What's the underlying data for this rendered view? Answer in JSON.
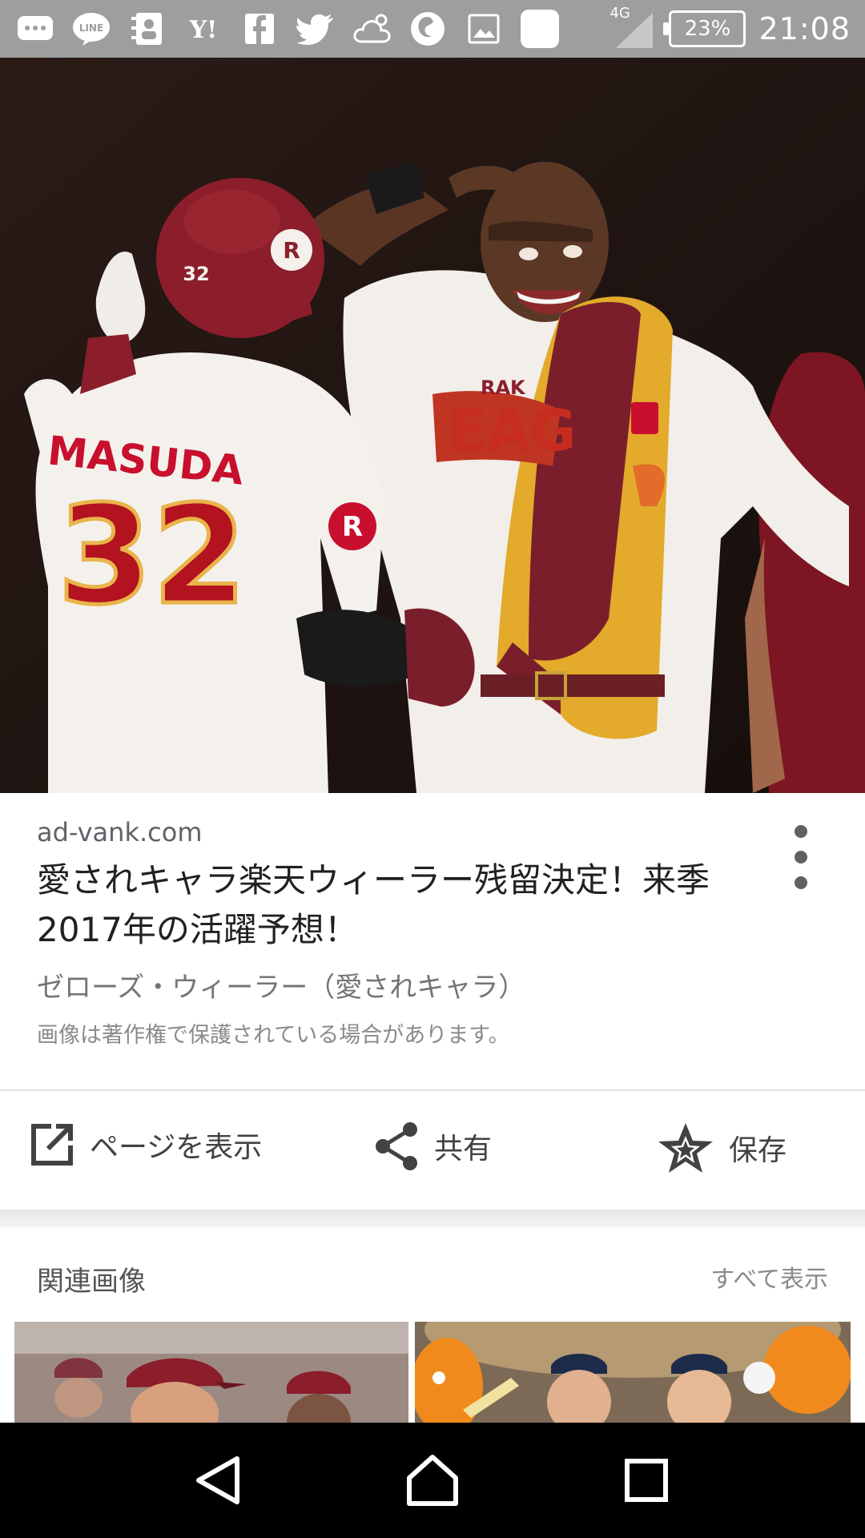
{
  "status_bar": {
    "battery_percent": "23%",
    "network": "4G",
    "time": "21:08",
    "icons": [
      "chat-bubble-icon",
      "line-icon",
      "contacts-icon",
      "yahoo-icon",
      "facebook-icon",
      "twitter-icon",
      "weather-icon",
      "firefox-icon",
      "image-icon",
      "blank-app-icon"
    ]
  },
  "hero": {
    "jersey_name": "MASUDA",
    "jersey_number": "32",
    "helmet_number": "32"
  },
  "info": {
    "domain": "ad-vank.com",
    "title": "愛されキャラ楽天ウィーラー残留決定！来季2017年の活躍予想！",
    "subtitle": "ゼローズ・ウィーラー（愛されキャラ）",
    "copyright_notice": "画像は著作権で保護されている場合があります。"
  },
  "actions": {
    "visit_label": "ページを表示",
    "share_label": "共有",
    "save_label": "保存"
  },
  "related": {
    "title": "関連画像",
    "see_all_label": "すべて表示"
  },
  "colors": {
    "status_bar": "#9e9e9e",
    "nav_bar": "#000000",
    "jersey_red": "#8b1e2a",
    "text_primary": "#212121"
  }
}
